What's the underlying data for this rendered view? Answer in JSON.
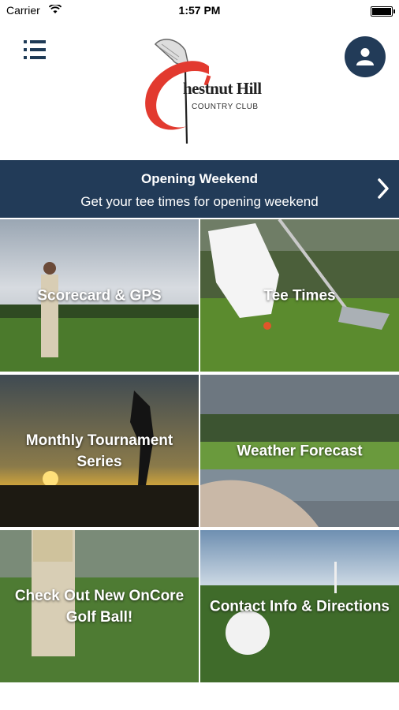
{
  "status_bar": {
    "carrier": "Carrier",
    "time": "1:57 PM"
  },
  "header": {
    "logo_name": "hestnut Hill",
    "logo_sub": "COUNTRY CLUB"
  },
  "banner": {
    "title": "Opening Weekend",
    "subtitle": "Get your tee times for opening weekend"
  },
  "tiles": [
    {
      "label": "Scorecard & GPS"
    },
    {
      "label": "Tee Times"
    },
    {
      "label": "Monthly Tournament Series"
    },
    {
      "label": "Weather Forecast"
    },
    {
      "label": "Check Out New OnCore Golf Ball!"
    },
    {
      "label": "Contact Info & Directions"
    }
  ],
  "colors": {
    "navy": "#223b58",
    "logo_red": "#e23a2f"
  }
}
